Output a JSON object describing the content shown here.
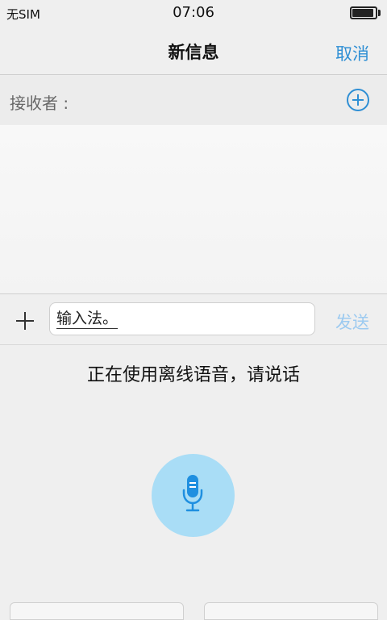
{
  "status_bar": {
    "carrier": "无SIM",
    "time": "07:06",
    "battery_level": 0.95
  },
  "nav": {
    "title": "新信息",
    "cancel_label": "取消"
  },
  "recipient": {
    "label": "接收者 :"
  },
  "compose": {
    "input_value": "输入法。",
    "send_label": "发送"
  },
  "voice": {
    "hint": "正在使用离线语音，请说话"
  },
  "icons": {
    "add_recipient": "plus-circle-icon",
    "compose_add": "plus-icon",
    "microphone": "microphone-icon"
  },
  "colors": {
    "accent": "#2f8fd4",
    "send_disabled": "#9ccaf0",
    "mic_bg": "#a9ddf6",
    "mic_icon": "#1f8fe0"
  }
}
